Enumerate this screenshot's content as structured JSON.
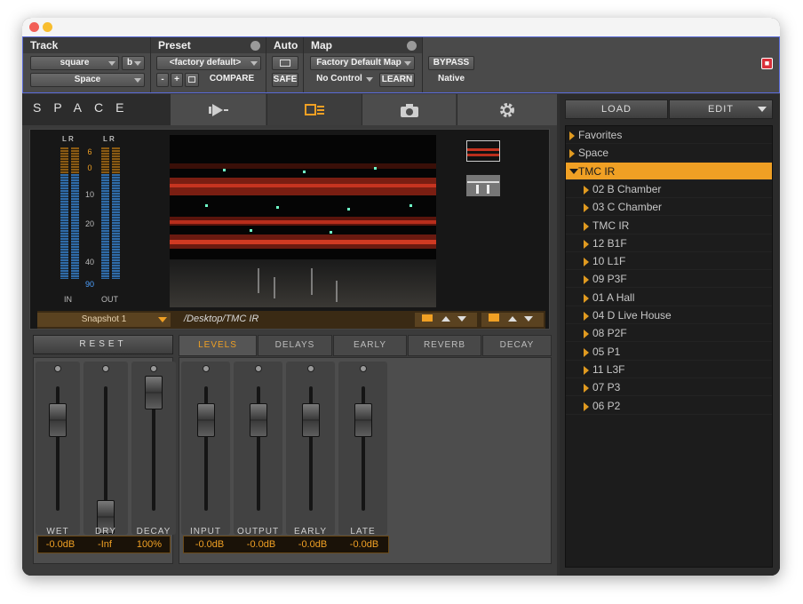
{
  "host": {
    "track": {
      "label": "Track",
      "name": "square",
      "channel": "b",
      "plugin": "Space"
    },
    "preset": {
      "label": "Preset",
      "value": "<factory default>",
      "minus": "-",
      "plus": "+",
      "compare": "COMPARE"
    },
    "auto": {
      "label": "Auto",
      "safe": "SAFE"
    },
    "map": {
      "label": "Map",
      "value": "Factory Default Map",
      "control": "No Control",
      "learn": "LEARN"
    },
    "bypass": "BYPASS",
    "native": "Native"
  },
  "plugin": {
    "brand": "SPACE",
    "tabs": [
      "playback-icon",
      "layout-icon",
      "camera-icon",
      "gear-icon"
    ],
    "meters": {
      "in_label": "IN",
      "out_label": "OUT",
      "channels": "L R",
      "scale": [
        "6",
        "0",
        "10",
        "20",
        "40",
        "90"
      ]
    },
    "snapshot": "Snapshot 1",
    "path": "/Desktop/TMC IR",
    "reset": "RESET",
    "param_tabs": [
      "LEVELS",
      "DELAYS",
      "EARLY",
      "REVERB",
      "DECAY"
    ],
    "active_param_tab": "LEVELS",
    "left_faders": [
      {
        "label": "WET",
        "value": "-0.0dB",
        "level": 0.78
      },
      {
        "label": "DRY",
        "value": "-Inf",
        "level": 0.0
      },
      {
        "label": "DECAY",
        "value": "100%",
        "level": 1.0
      }
    ],
    "level_faders": [
      {
        "label": "INPUT",
        "value": "-0.0dB",
        "level": 0.78
      },
      {
        "label": "OUTPUT",
        "value": "-0.0dB",
        "level": 0.78
      },
      {
        "label": "EARLY",
        "value": "-0.0dB",
        "level": 0.78
      },
      {
        "label": "LATE",
        "value": "-0.0dB",
        "level": 0.78
      }
    ]
  },
  "browser": {
    "load": "LOAD",
    "edit": "EDIT",
    "items": [
      {
        "label": "Favorites",
        "depth": 0
      },
      {
        "label": "Space",
        "depth": 0
      },
      {
        "label": "TMC IR",
        "depth": 0,
        "selected": true
      },
      {
        "label": "02 B Chamber",
        "depth": 1
      },
      {
        "label": "03 C Chamber",
        "depth": 1
      },
      {
        "label": "TMC IR",
        "depth": 1
      },
      {
        "label": "12 B1F",
        "depth": 1
      },
      {
        "label": "10 L1F",
        "depth": 1
      },
      {
        "label": "09 P3F",
        "depth": 1
      },
      {
        "label": "01 A Hall",
        "depth": 1
      },
      {
        "label": "04 D Live House",
        "depth": 1
      },
      {
        "label": "08 P2F",
        "depth": 1
      },
      {
        "label": "05 P1",
        "depth": 1
      },
      {
        "label": "11 L3F",
        "depth": 1
      },
      {
        "label": "07 P3",
        "depth": 1
      },
      {
        "label": "06 P2",
        "depth": 1
      }
    ]
  },
  "colors": {
    "accent": "#f0a024",
    "meter_blue": "#2f6ba8",
    "selection": "#f0a024"
  }
}
